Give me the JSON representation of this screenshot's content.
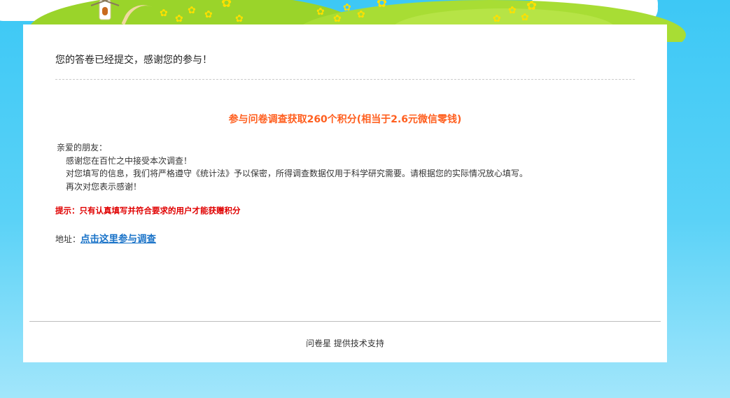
{
  "colors": {
    "sky": "#3dc8f5",
    "reward_text": "#ff5f1f",
    "tip_text": "#e00000",
    "link": "#1a73c8"
  },
  "banner": {
    "icons": [
      "cloud-icon",
      "hill-icon",
      "windmill-icon",
      "flower-icon"
    ]
  },
  "result": {
    "title": "您的答卷已经提交，感谢您的参与！",
    "reward": "参与问卷调查获取260个积分(相当于2.6元微信零钱)"
  },
  "letter": {
    "greeting": "亲爱的朋友：",
    "line1": "感谢您在百忙之中接受本次调查！",
    "line2": "对您填写的信息，我们将严格遵守《统计法》予以保密，所得调查数据仅用于科学研究需要。请根据您的实际情况放心填写。",
    "line3": "再次对您表示感谢！"
  },
  "tip": "提示：只有认真填写并符合要求的用户才能获赠积分",
  "address": {
    "label": "地址：",
    "link_text": "点击这里参与调查"
  },
  "footer": {
    "text": "问卷星 提供技术支持"
  }
}
